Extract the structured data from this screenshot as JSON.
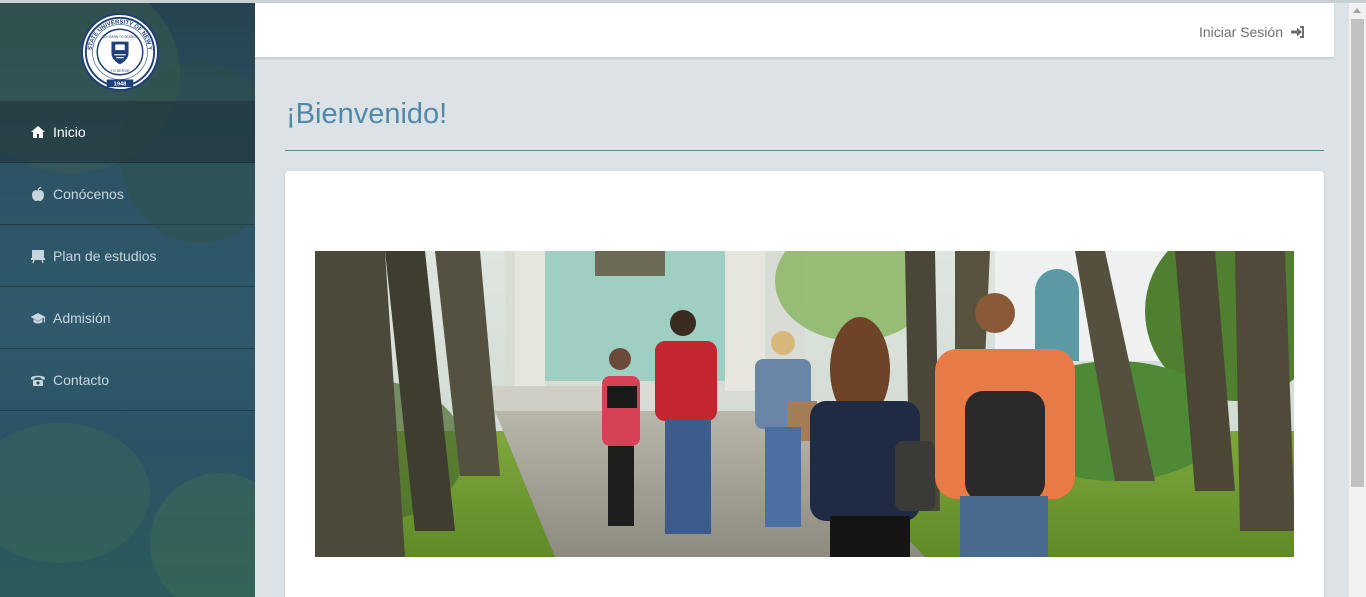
{
  "sidebar": {
    "logo": {
      "ring_text": "STATE UNIVERSITY OF NEW YORK",
      "inner_text_top": "TO LEARN TO SEARCH",
      "inner_text_bottom": "TO SERVE",
      "year": "1948"
    },
    "items": [
      {
        "label": "Inicio",
        "icon": "home-icon",
        "active": true
      },
      {
        "label": "Conócenos",
        "icon": "apple-icon",
        "active": false
      },
      {
        "label": "Plan de estudios",
        "icon": "blackboard-icon",
        "active": false
      },
      {
        "label": "Admisión",
        "icon": "education-icon",
        "active": false
      },
      {
        "label": "Contacto",
        "icon": "phone-icon",
        "active": false
      }
    ]
  },
  "header": {
    "login_label": "Iniciar Sesión",
    "login_icon": "log-in-icon"
  },
  "main": {
    "title": "¡Bienvenido!",
    "hero_image": "students-walking-campus-photo"
  },
  "colors": {
    "title": "#4f8aab",
    "sidebar": "#2d5466",
    "background": "#dce2e6"
  }
}
